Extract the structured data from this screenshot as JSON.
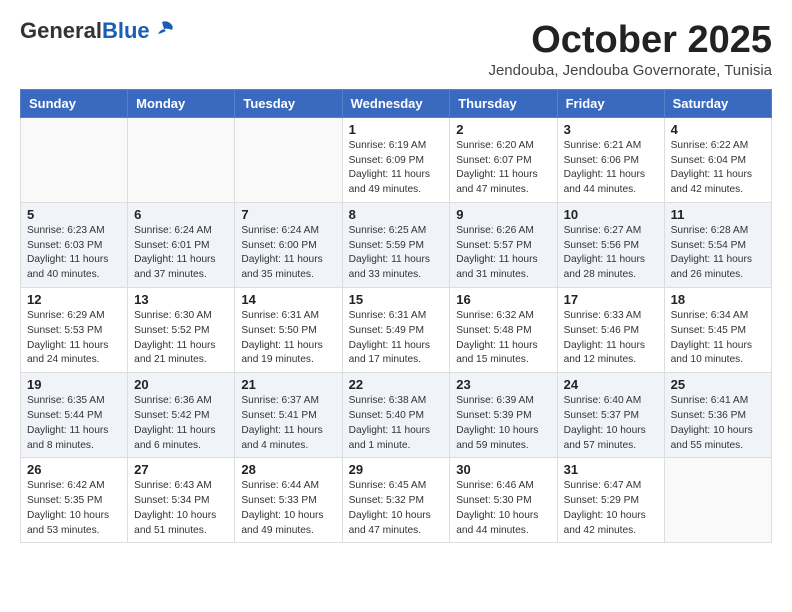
{
  "header": {
    "logo_general": "General",
    "logo_blue": "Blue",
    "month_title": "October 2025",
    "location": "Jendouba, Jendouba Governorate, Tunisia"
  },
  "days_of_week": [
    "Sunday",
    "Monday",
    "Tuesday",
    "Wednesday",
    "Thursday",
    "Friday",
    "Saturday"
  ],
  "weeks": [
    [
      {
        "day": "",
        "info": ""
      },
      {
        "day": "",
        "info": ""
      },
      {
        "day": "",
        "info": ""
      },
      {
        "day": "1",
        "info": "Sunrise: 6:19 AM\nSunset: 6:09 PM\nDaylight: 11 hours\nand 49 minutes."
      },
      {
        "day": "2",
        "info": "Sunrise: 6:20 AM\nSunset: 6:07 PM\nDaylight: 11 hours\nand 47 minutes."
      },
      {
        "day": "3",
        "info": "Sunrise: 6:21 AM\nSunset: 6:06 PM\nDaylight: 11 hours\nand 44 minutes."
      },
      {
        "day": "4",
        "info": "Sunrise: 6:22 AM\nSunset: 6:04 PM\nDaylight: 11 hours\nand 42 minutes."
      }
    ],
    [
      {
        "day": "5",
        "info": "Sunrise: 6:23 AM\nSunset: 6:03 PM\nDaylight: 11 hours\nand 40 minutes."
      },
      {
        "day": "6",
        "info": "Sunrise: 6:24 AM\nSunset: 6:01 PM\nDaylight: 11 hours\nand 37 minutes."
      },
      {
        "day": "7",
        "info": "Sunrise: 6:24 AM\nSunset: 6:00 PM\nDaylight: 11 hours\nand 35 minutes."
      },
      {
        "day": "8",
        "info": "Sunrise: 6:25 AM\nSunset: 5:59 PM\nDaylight: 11 hours\nand 33 minutes."
      },
      {
        "day": "9",
        "info": "Sunrise: 6:26 AM\nSunset: 5:57 PM\nDaylight: 11 hours\nand 31 minutes."
      },
      {
        "day": "10",
        "info": "Sunrise: 6:27 AM\nSunset: 5:56 PM\nDaylight: 11 hours\nand 28 minutes."
      },
      {
        "day": "11",
        "info": "Sunrise: 6:28 AM\nSunset: 5:54 PM\nDaylight: 11 hours\nand 26 minutes."
      }
    ],
    [
      {
        "day": "12",
        "info": "Sunrise: 6:29 AM\nSunset: 5:53 PM\nDaylight: 11 hours\nand 24 minutes."
      },
      {
        "day": "13",
        "info": "Sunrise: 6:30 AM\nSunset: 5:52 PM\nDaylight: 11 hours\nand 21 minutes."
      },
      {
        "day": "14",
        "info": "Sunrise: 6:31 AM\nSunset: 5:50 PM\nDaylight: 11 hours\nand 19 minutes."
      },
      {
        "day": "15",
        "info": "Sunrise: 6:31 AM\nSunset: 5:49 PM\nDaylight: 11 hours\nand 17 minutes."
      },
      {
        "day": "16",
        "info": "Sunrise: 6:32 AM\nSunset: 5:48 PM\nDaylight: 11 hours\nand 15 minutes."
      },
      {
        "day": "17",
        "info": "Sunrise: 6:33 AM\nSunset: 5:46 PM\nDaylight: 11 hours\nand 12 minutes."
      },
      {
        "day": "18",
        "info": "Sunrise: 6:34 AM\nSunset: 5:45 PM\nDaylight: 11 hours\nand 10 minutes."
      }
    ],
    [
      {
        "day": "19",
        "info": "Sunrise: 6:35 AM\nSunset: 5:44 PM\nDaylight: 11 hours\nand 8 minutes."
      },
      {
        "day": "20",
        "info": "Sunrise: 6:36 AM\nSunset: 5:42 PM\nDaylight: 11 hours\nand 6 minutes."
      },
      {
        "day": "21",
        "info": "Sunrise: 6:37 AM\nSunset: 5:41 PM\nDaylight: 11 hours\nand 4 minutes."
      },
      {
        "day": "22",
        "info": "Sunrise: 6:38 AM\nSunset: 5:40 PM\nDaylight: 11 hours\nand 1 minute."
      },
      {
        "day": "23",
        "info": "Sunrise: 6:39 AM\nSunset: 5:39 PM\nDaylight: 10 hours\nand 59 minutes."
      },
      {
        "day": "24",
        "info": "Sunrise: 6:40 AM\nSunset: 5:37 PM\nDaylight: 10 hours\nand 57 minutes."
      },
      {
        "day": "25",
        "info": "Sunrise: 6:41 AM\nSunset: 5:36 PM\nDaylight: 10 hours\nand 55 minutes."
      }
    ],
    [
      {
        "day": "26",
        "info": "Sunrise: 6:42 AM\nSunset: 5:35 PM\nDaylight: 10 hours\nand 53 minutes."
      },
      {
        "day": "27",
        "info": "Sunrise: 6:43 AM\nSunset: 5:34 PM\nDaylight: 10 hours\nand 51 minutes."
      },
      {
        "day": "28",
        "info": "Sunrise: 6:44 AM\nSunset: 5:33 PM\nDaylight: 10 hours\nand 49 minutes."
      },
      {
        "day": "29",
        "info": "Sunrise: 6:45 AM\nSunset: 5:32 PM\nDaylight: 10 hours\nand 47 minutes."
      },
      {
        "day": "30",
        "info": "Sunrise: 6:46 AM\nSunset: 5:30 PM\nDaylight: 10 hours\nand 44 minutes."
      },
      {
        "day": "31",
        "info": "Sunrise: 6:47 AM\nSunset: 5:29 PM\nDaylight: 10 hours\nand 42 minutes."
      },
      {
        "day": "",
        "info": ""
      }
    ]
  ]
}
